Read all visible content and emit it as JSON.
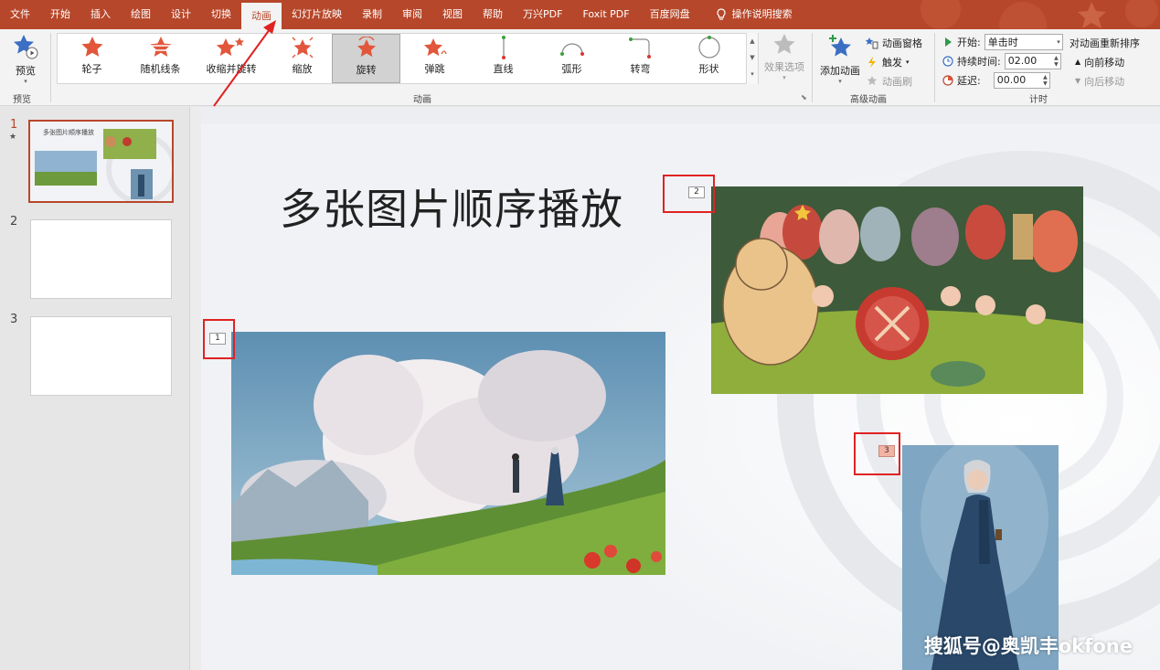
{
  "menu": {
    "tabs": [
      "文件",
      "开始",
      "插入",
      "绘图",
      "设计",
      "切换",
      "动画",
      "幻灯片放映",
      "录制",
      "审阅",
      "视图",
      "帮助",
      "万兴PDF",
      "Foxit PDF",
      "百度网盘"
    ],
    "active_tab": "动画",
    "tell_me": "操作说明搜索"
  },
  "ribbon": {
    "preview": {
      "button": "预览",
      "group": "预览"
    },
    "animations": {
      "group": "动画",
      "items": [
        "轮子",
        "随机线条",
        "收缩并旋转",
        "缩放",
        "旋转",
        "弹跳",
        "直线",
        "弧形",
        "转弯",
        "形状"
      ],
      "selected": "旋转"
    },
    "effect_options": "效果选项",
    "advanced": {
      "group": "高级动画",
      "add_animation": "添加动画",
      "animation_pane": "动画窗格",
      "trigger": "触发",
      "painter": "动画刷"
    },
    "timing": {
      "group": "计时",
      "start_label": "开始:",
      "start_value": "单击时",
      "duration_label": "持续时间:",
      "duration_value": "02.00",
      "delay_label": "延迟:",
      "delay_value": "00.00",
      "reorder_title": "对动画重新排序",
      "move_earlier": "向前移动",
      "move_later": "向后移动"
    }
  },
  "slides": {
    "numbers": [
      "1",
      "2",
      "3"
    ],
    "thumb1_title": "多张图片顺序播放"
  },
  "slide": {
    "title": "多张图片顺序播放",
    "tags": [
      "1",
      "2",
      "3"
    ]
  },
  "watermark": "搜狐号@奥凯丰okfone",
  "colors": {
    "accent": "#b7472a",
    "highlight_box": "#e02222",
    "selected_tag": "#f3b2a3"
  }
}
